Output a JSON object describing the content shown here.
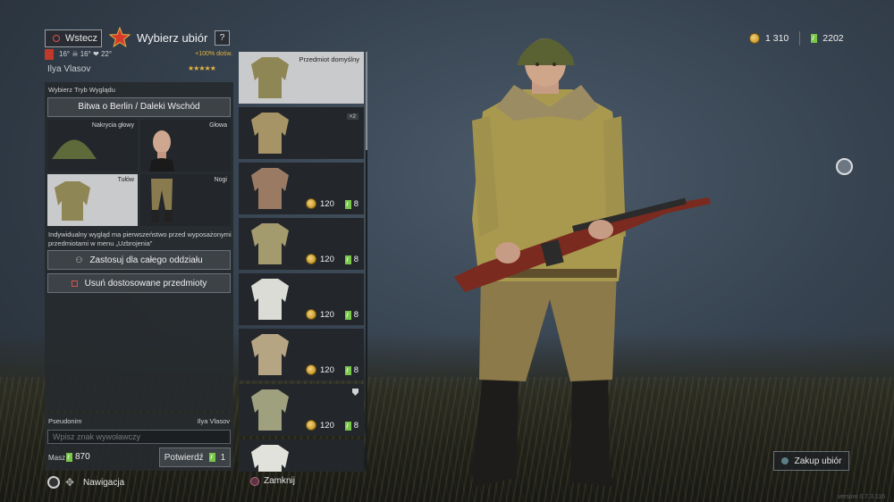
{
  "header": {
    "back_label": "Wstecz",
    "title": "Wybierz ubiór",
    "help_label": "?"
  },
  "soldier": {
    "stats": "16°  ☠ 16°  ❤ 22°",
    "bonus": "+100% dośw.",
    "name": "Ilya Vlasov",
    "rating": "★★★★★"
  },
  "left_panel": {
    "mode_label": "Wybierz Tryb Wyglądu",
    "mode_button": "Bitwa o Berlin / Daleki Wschód",
    "slots": [
      {
        "label": "Nakrycia głowy"
      },
      {
        "label": "Głowa"
      },
      {
        "label": "Tułów"
      },
      {
        "label": "Nogi"
      }
    ],
    "note": "Indywidualny wygląd ma pierwszeństwo przed wyposażonymi przedmiotami w menu „Uzbrojenia\"",
    "apply_squad": "Zastosuj dla całego oddziału",
    "remove_custom": "Usuń dostosowane przedmioty"
  },
  "nickname": {
    "label": "Pseudonim",
    "current": "Ilya Vlasov",
    "placeholder": "Wpisz znak wywoławczy",
    "mask_label": "Masz",
    "mask_value": "870",
    "confirm_label": "Potwierdź",
    "confirm_cost": "1"
  },
  "items": [
    {
      "label": "Przedmiot domyślny",
      "selected": true
    },
    {
      "badge": "×2"
    },
    {
      "price_gold": "120",
      "price_order": "8"
    },
    {
      "price_gold": "120",
      "price_order": "8"
    },
    {
      "price_gold": "120",
      "price_order": "8"
    },
    {
      "price_gold": "120",
      "price_order": "8"
    },
    {
      "price_gold": "120",
      "price_order": "8"
    },
    {}
  ],
  "currency": {
    "gold": "1 310",
    "orders": "2202"
  },
  "buy_button": "Zakup ubiór",
  "footer": {
    "navigation": "Nawigacja",
    "close": "Zamknij",
    "version": "version 0.7.3.116"
  },
  "colors": {
    "accent_gold": "#e3b341",
    "panel": "#26292e",
    "selected": "#c9cacb",
    "order_green": "#7bc74d"
  }
}
